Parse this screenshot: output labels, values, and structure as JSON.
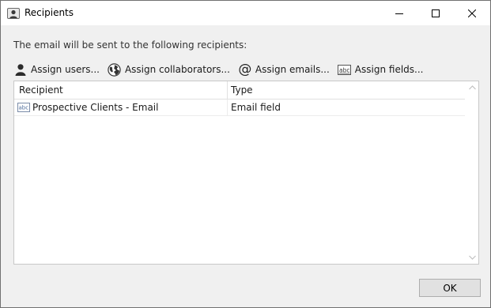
{
  "window": {
    "title": "Recipients"
  },
  "intro_text": "The email will be sent to the following recipients:",
  "toolbar": {
    "assign_users": "Assign users...",
    "assign_collaborators": "Assign collaborators...",
    "assign_emails": "Assign emails...",
    "assign_fields": "Assign fields...",
    "at_glyph": "@"
  },
  "grid": {
    "columns": [
      "Recipient",
      "Type"
    ],
    "rows": [
      {
        "recipient": "Prospective Clients - Email",
        "type": "Email field",
        "icon": "abc-field-icon"
      }
    ]
  },
  "footer": {
    "ok_label": "OK"
  },
  "colors": {
    "window_bg": "#f0f0f0",
    "titlebar_bg": "#ffffff",
    "button_bg": "#e1e1e1",
    "border": "#c8c8c8"
  }
}
